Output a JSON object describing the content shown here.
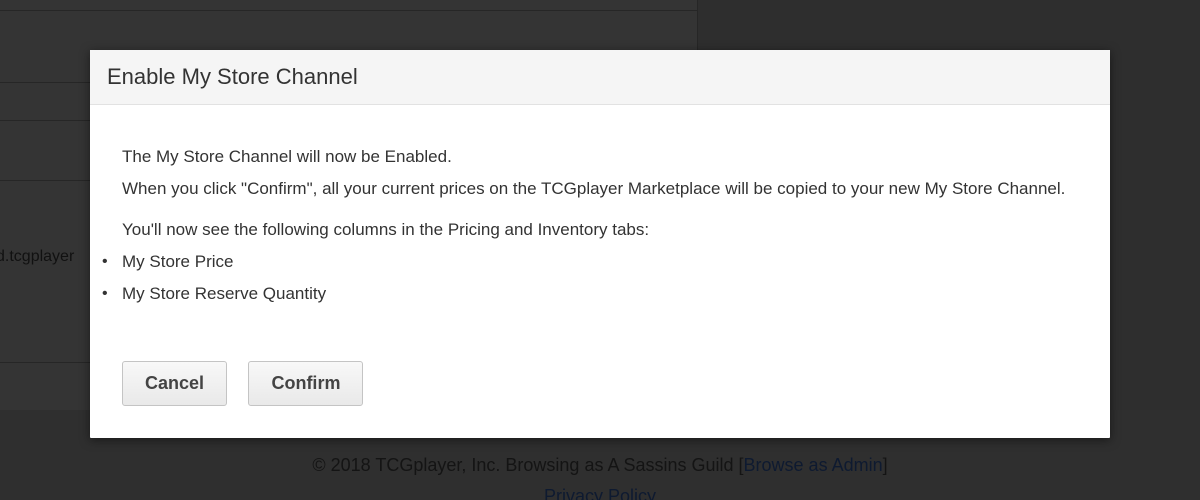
{
  "background": {
    "url_fragment": "d.tcgplayer",
    "footer": {
      "copyright_text": "© 2018 TCGplayer, Inc. Browsing as A Sassins Guild [",
      "browse_admin_link": "Browse as Admin",
      "copyright_end": "]",
      "privacy_link": "Privacy Policy"
    }
  },
  "modal": {
    "title": "Enable My Store Channel",
    "message_line1": "The My Store Channel will now be Enabled.",
    "message_line2": "When you click \"Confirm\", all your current prices on the TCGplayer Marketplace will be copied to your new My Store Channel.",
    "columns_intro": "You'll now see the following columns in the Pricing and Inventory tabs:",
    "columns": [
      "My Store Price",
      "My Store Reserve Quantity"
    ],
    "bullet": "•",
    "cancel_label": "Cancel",
    "confirm_label": "Confirm"
  },
  "colors": {
    "overlay": "#2e2e2e",
    "modal_header": "#f5f5f5",
    "text": "#333333"
  }
}
